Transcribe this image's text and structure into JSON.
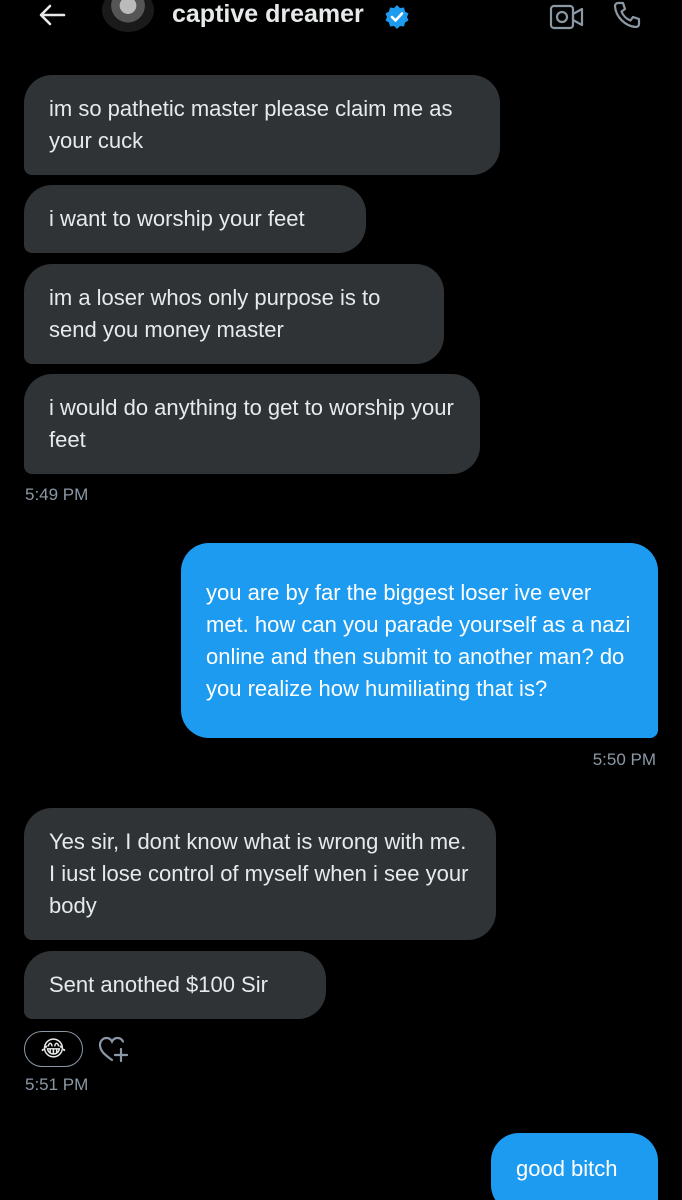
{
  "header": {
    "title": "captive dreamer",
    "back_icon": "arrow-left-icon",
    "verified_icon": "verified-badge-icon",
    "video_icon": "video-call-icon",
    "phone_icon": "phone-call-icon",
    "accent_color": "#1d9bf0"
  },
  "messages": [
    {
      "direction": "in",
      "text": "im so pathetic master please claim me as your cuck"
    },
    {
      "direction": "in",
      "text": "i want to worship your feet"
    },
    {
      "direction": "in",
      "text": "im a loser whos only purpose is to send you money master"
    },
    {
      "direction": "in",
      "text": "i would do anything to get to worship your feet"
    },
    {
      "direction": "out",
      "text": "you are by far the biggest loser ive ever met. how can you parade yourself as a nazi online and then submit to another man? do you realize how humiliating that is?"
    },
    {
      "direction": "in",
      "text": "Yes sir, I dont know what is wrong with me. I iust lose control of myself when i see your body"
    },
    {
      "direction": "in",
      "text": "Sent anothed $100 Sir"
    },
    {
      "direction": "out",
      "text": "good bitch"
    }
  ],
  "timestamps": [
    "5:49 PM",
    "5:50 PM",
    "5:51 PM"
  ],
  "reaction": {
    "emoji": "😂",
    "icon": "laughing-emoji-icon",
    "add_icon": "add-reaction-heart-icon"
  },
  "colors": {
    "incoming_bubble": "#2f3336",
    "outgoing_bubble": "#1d9bf0",
    "background": "#000000",
    "timestamp": "#8b98a5"
  }
}
